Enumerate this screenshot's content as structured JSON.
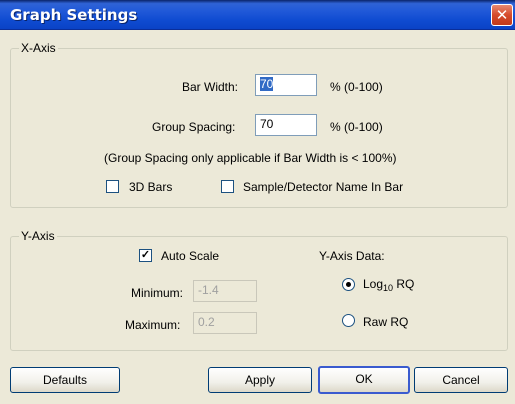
{
  "window": {
    "title": "Graph Settings"
  },
  "x_axis": {
    "group_label": "X-Axis",
    "bar_width_label": "Bar Width:",
    "bar_width_value": "70",
    "bar_width_range": "% (0-100)",
    "group_spacing_label": "Group Spacing:",
    "group_spacing_value": "70",
    "group_spacing_range": "% (0-100)",
    "note": "(Group Spacing only applicable if Bar Width is < 100%)",
    "bars3d_label": "3D Bars",
    "bars3d_checked": false,
    "sample_name_label": "Sample/Detector Name In Bar",
    "sample_name_checked": false
  },
  "y_axis": {
    "group_label": "Y-Axis",
    "auto_scale_label": "Auto Scale",
    "auto_scale_checked": true,
    "minimum_label": "Minimum:",
    "minimum_value": "-1.4",
    "maximum_label": "Maximum:",
    "maximum_value": "0.2",
    "data_label": "Y-Axis Data:",
    "log_prefix": "Log",
    "log_sub": "10",
    "log_suffix": " RQ",
    "log_selected": true,
    "raw_label": "Raw RQ",
    "raw_selected": false
  },
  "buttons": {
    "defaults": "Defaults",
    "apply": "Apply",
    "ok": "OK",
    "cancel": "Cancel"
  }
}
